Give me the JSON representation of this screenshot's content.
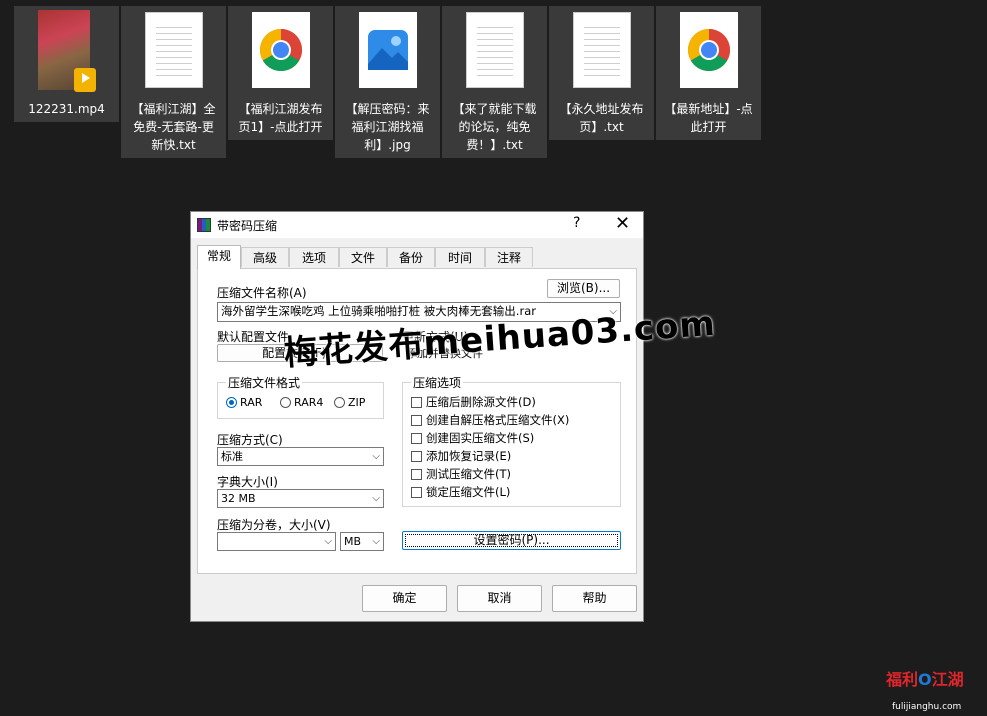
{
  "desktop": {
    "files": [
      {
        "name": "122231.mp4",
        "icon": "video-thumbnail-icon",
        "badge": "Player"
      },
      {
        "name": "【福利江湖】全\n免费-无套路-更\n新快.txt",
        "icon": "text-file-icon"
      },
      {
        "name": "【福利江湖发布\n页1】-点此打开",
        "icon": "chrome-icon"
      },
      {
        "name": "【解压密码：来\n福利江湖找福\n利】.jpg",
        "icon": "image-file-icon"
      },
      {
        "name": "【来了就能下载\n的论坛，纯免\n费！】.txt",
        "icon": "text-file-icon"
      },
      {
        "name": "【永久地址发布\n页】.txt",
        "icon": "text-file-icon"
      },
      {
        "name": "【最新地址】-点\n此打开",
        "icon": "chrome-icon"
      }
    ]
  },
  "dialog": {
    "title": "带密码压缩",
    "help": "?",
    "close": "✕",
    "tabs": [
      "常规",
      "高级",
      "选项",
      "文件",
      "备份",
      "时间",
      "注释"
    ],
    "archive_name_label": "压缩文件名称(A)",
    "browse_label": "浏览(B)...",
    "archive_name_value": "海外留学生深喉吃鸡 上位骑乘啪啪打桩 被大肉棒无套输出.rar",
    "profile_label": "默认配置文件",
    "profile_button": "配置文件(F)...",
    "update_mode_label": "更新方式(U)",
    "update_mode_value": "添加并替换文件",
    "format_group": "压缩文件格式",
    "formats": [
      {
        "label": "RAR",
        "checked": true
      },
      {
        "label": "RAR4",
        "checked": false
      },
      {
        "label": "ZIP",
        "checked": false
      }
    ],
    "method_label": "压缩方式(C)",
    "method_value": "标准",
    "dict_label": "字典大小(I)",
    "dict_value": "32 MB",
    "volume_label": "压缩为分卷，大小(V)",
    "volume_value": "",
    "volume_unit": "MB",
    "options_group": "压缩选项",
    "options": [
      "压缩后删除源文件(D)",
      "创建自解压格式压缩文件(X)",
      "创建固实压缩文件(S)",
      "添加恢复记录(E)",
      "测试压缩文件(T)",
      "锁定压缩文件(L)"
    ],
    "set_password": "设置密码(P)...",
    "ok": "确定",
    "cancel": "取消",
    "help_button": "帮助"
  },
  "watermark": "梅花发布meihua03.com",
  "logo": {
    "left": "福利",
    "mid": "O",
    "right": "江湖",
    "url": "fulijianghu.com"
  }
}
